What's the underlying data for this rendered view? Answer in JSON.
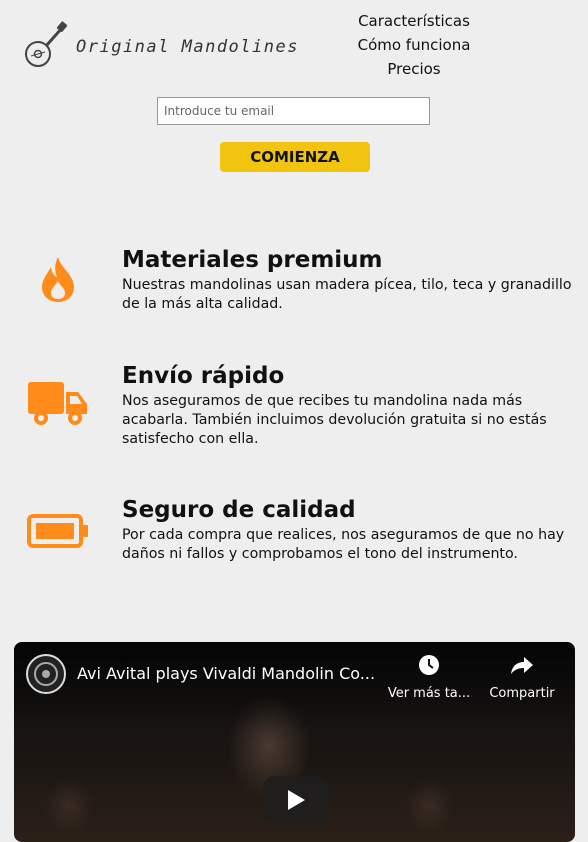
{
  "header": {
    "logo_text": "Original Mandolines",
    "nav": [
      {
        "label": "Características"
      },
      {
        "label": "Cómo funciona"
      },
      {
        "label": "Precios"
      }
    ]
  },
  "signup": {
    "email_placeholder": "Introduce tu email",
    "button_label": "COMIENZA"
  },
  "features": [
    {
      "icon": "fire-icon",
      "title": "Materiales premium",
      "text": "Nuestras mandolinas usan madera pícea, tilo, teca y granadillo de la más alta calidad."
    },
    {
      "icon": "truck-icon",
      "title": "Envío rápido",
      "text": "Nos aseguramos de que recibes tu mandolina nada más acabarla. También incluimos devolución gratuita si no estás satisfecho con ella."
    },
    {
      "icon": "battery-icon",
      "title": "Seguro de calidad",
      "text": "Por cada compra que realices, nos aseguramos de que no hay daños ni fallos y comprobamos el tono del instrumento."
    }
  ],
  "video": {
    "title": "Avi Avital plays Vivaldi Mandolin Co...",
    "watch_later": "Ver más ta...",
    "share": "Compartir"
  },
  "colors": {
    "accent": "#f1c40f",
    "icon": "#ff8c1a",
    "background": "#eeeeee"
  }
}
